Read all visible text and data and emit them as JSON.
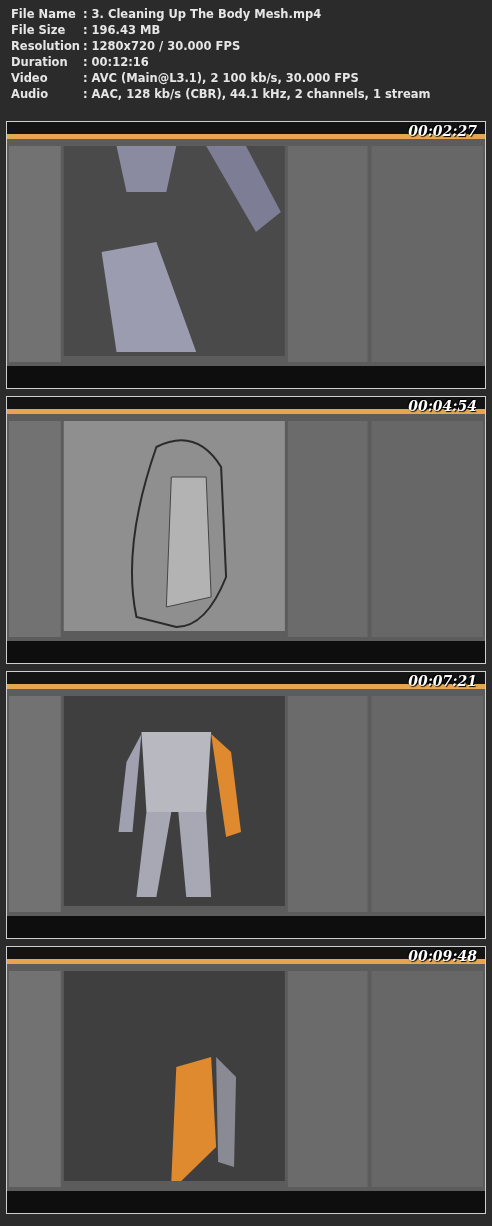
{
  "file_info": [
    {
      "label": "File Name",
      "value": ": 3. Cleaning Up The Body Mesh.mp4"
    },
    {
      "label": "File Size",
      "value": ": 196.43 MB"
    },
    {
      "label": "Resolution",
      "value": ": 1280x720 / 30.000 FPS"
    },
    {
      "label": "Duration",
      "value": ": 00:12:16"
    },
    {
      "label": "Video",
      "value": ": AVC (Main@L3.1), 2 100 kb/s, 30.000 FPS"
    },
    {
      "label": "Audio",
      "value": ": AAC, 128 kb/s (CBR), 44.1 kHz, 2 channels, 1 stream"
    }
  ],
  "frames": [
    {
      "kind": "picture",
      "timestamp": "00:02:27"
    },
    {
      "kind": "picture",
      "timestamp": "00:04:54"
    },
    {
      "kind": "picture",
      "timestamp": "00:07:21"
    },
    {
      "kind": "picture",
      "timestamp": "00:09:48"
    }
  ]
}
